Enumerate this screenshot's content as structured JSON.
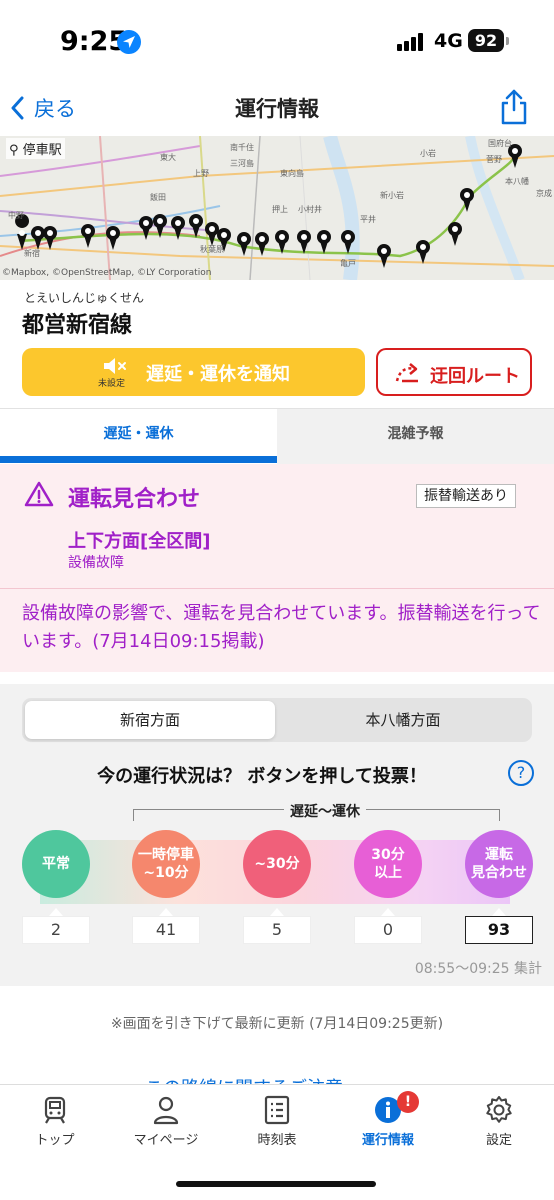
{
  "status_bar": {
    "time": "9:25",
    "network": "4G",
    "battery": "92"
  },
  "nav": {
    "back_label": "戻る",
    "title": "運行情報"
  },
  "map": {
    "label": "停車駅",
    "credit": "©Mapbox, ©OpenStreetMap, ©LY Corporation",
    "place_labels": [
      "中野",
      "東大",
      "上野",
      "押上",
      "小村井",
      "平井",
      "新小岩",
      "小岩",
      "本八幡",
      "京成",
      "国府台",
      "菅野",
      "南千住",
      "東向島",
      "秋葉原",
      "新宿",
      "飯田",
      "三河島",
      "亀戸"
    ]
  },
  "line": {
    "ruby": "とえいしんじゅくせん",
    "name": "都営新宿線"
  },
  "actions": {
    "mute_sub": "未設定",
    "notify_label": "遅延・運休を通知",
    "detour_label": "迂回ルート"
  },
  "tabs": {
    "delay": "遅延・運休",
    "crowd": "混雑予報"
  },
  "alert": {
    "title": "運転見合わせ",
    "badge": "振替輸送あり",
    "direction": "上下方面[全区間]",
    "cause": "設備故障",
    "message": "設備故障の影響で、運転を見合わせています。振替輸送を行っています。(7月14日09:15掲載)"
  },
  "vote": {
    "directions": [
      "新宿方面",
      "本八幡方面"
    ],
    "question": "今の運行状況は？ ボタンを押して投票！",
    "range_label": "遅延〜運休",
    "options": [
      {
        "line1": "平常",
        "line2": "",
        "count": "2",
        "color": "#4fc79d"
      },
      {
        "line1": "一時停車",
        "line2": "~10分",
        "count": "41",
        "color": "#f5876d"
      },
      {
        "line1": "~30分",
        "line2": "",
        "count": "5",
        "color": "#f0607a"
      },
      {
        "line1": "30分",
        "line2": "以上",
        "count": "0",
        "color": "#e75fd6"
      },
      {
        "line1": "運転",
        "line2": "見合わせ",
        "count": "93",
        "color": "#c769e6"
      }
    ],
    "tally_time": "08:55〜09:25 集計"
  },
  "refresh_note": "※画面を引き下げて最新に更新 (7月14日09:25更新)",
  "hidden_link": "この路線に関するご注意",
  "tabbar": {
    "items": [
      {
        "label": "トップ",
        "icon": "train-icon"
      },
      {
        "label": "マイページ",
        "icon": "person-icon"
      },
      {
        "label": "時刻表",
        "icon": "timetable-icon"
      },
      {
        "label": "運行情報",
        "icon": "info-icon"
      },
      {
        "label": "設定",
        "icon": "gear-icon"
      }
    ],
    "badge": "!"
  }
}
